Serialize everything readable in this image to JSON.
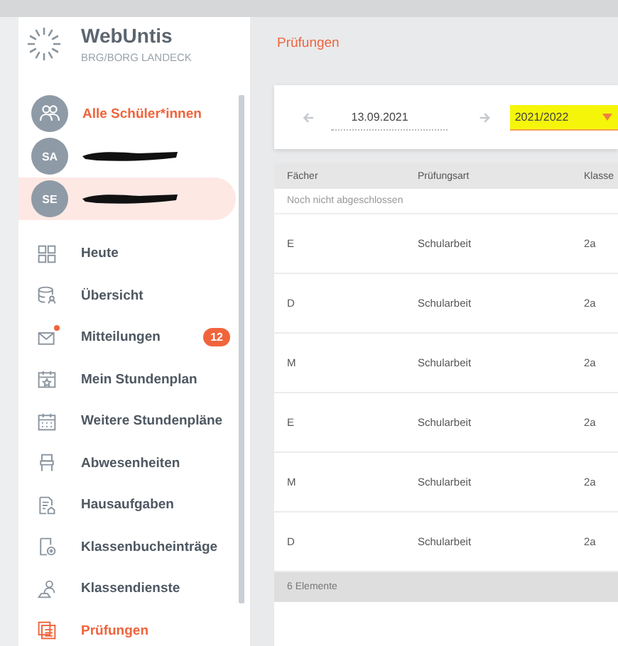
{
  "app": {
    "name": "WebUntis",
    "school": "BRG/BORG LANDECK"
  },
  "students": [
    {
      "kind": "all",
      "label": "Alle Schüler*innen",
      "selected": false
    },
    {
      "kind": "student",
      "initials": "SA",
      "redacted": true,
      "selected": false
    },
    {
      "kind": "student",
      "initials": "SE",
      "redacted": true,
      "selected": true
    }
  ],
  "nav": [
    {
      "label": "Heute",
      "selected": false
    },
    {
      "label": "Übersicht",
      "selected": false
    },
    {
      "label": "Mitteilungen",
      "selected": false,
      "unread": true,
      "badge": "12"
    },
    {
      "label": "Mein Stundenplan",
      "selected": false
    },
    {
      "label": "Weitere Stundenpläne",
      "selected": false
    },
    {
      "label": "Abwesenheiten",
      "selected": false
    },
    {
      "label": "Hausaufgaben",
      "selected": false
    },
    {
      "label": "Klassenbucheinträge",
      "selected": false
    },
    {
      "label": "Klassendienste",
      "selected": false
    },
    {
      "label": "Prüfungen",
      "selected": true
    }
  ],
  "page": {
    "title": "Prüfungen"
  },
  "filter": {
    "date": "13.09.2021",
    "school_year": "2021/2022",
    "highlighted": true
  },
  "table": {
    "columns": [
      "Fächer",
      "Prüfungsart",
      "Klasse"
    ],
    "group": "Noch nicht abgeschlossen",
    "rows": [
      [
        "E",
        "Schularbeit",
        "2a"
      ],
      [
        "D",
        "Schularbeit",
        "2a"
      ],
      [
        "M",
        "Schularbeit",
        "2a"
      ],
      [
        "E",
        "Schularbeit",
        "2a"
      ],
      [
        "M",
        "Schularbeit",
        "2a"
      ],
      [
        "D",
        "Schularbeit",
        "2a"
      ]
    ],
    "footer": "6 Elemente"
  }
}
